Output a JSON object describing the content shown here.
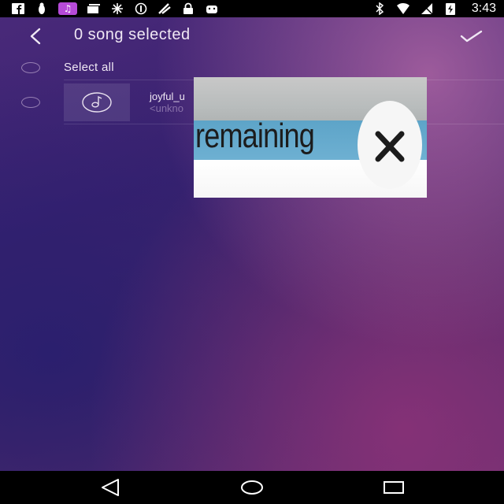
{
  "status_bar": {
    "time": "3:43",
    "left_icons": [
      "facebook-icon",
      "bug-icon",
      "music-notification-icon",
      "cards-icon",
      "star-icon",
      "info-icon",
      "spam-icon",
      "lock-icon",
      "android-icon"
    ],
    "right_icons": [
      "bluetooth-icon",
      "wifi-icon",
      "signal-icon",
      "battery-charging-icon"
    ]
  },
  "header": {
    "title": "0 song selected",
    "back_icon": "chevron-left-icon",
    "confirm_icon": "check-icon"
  },
  "list": {
    "select_all_label": "Select all",
    "songs": [
      {
        "title": "joyful_u",
        "artist": "<unkno"
      }
    ]
  },
  "overlay_ad": {
    "text": "remaining",
    "close_icon": "close-icon"
  },
  "nav_bar": {
    "icons": [
      "back-triangle-icon",
      "home-circle-icon",
      "recents-square-icon"
    ]
  },
  "colors": {
    "status_bar_bg": "#000000",
    "music_badge": "#b64ad8",
    "text_primary": "#f0e8f4",
    "ad_band": "#5da4c8"
  }
}
